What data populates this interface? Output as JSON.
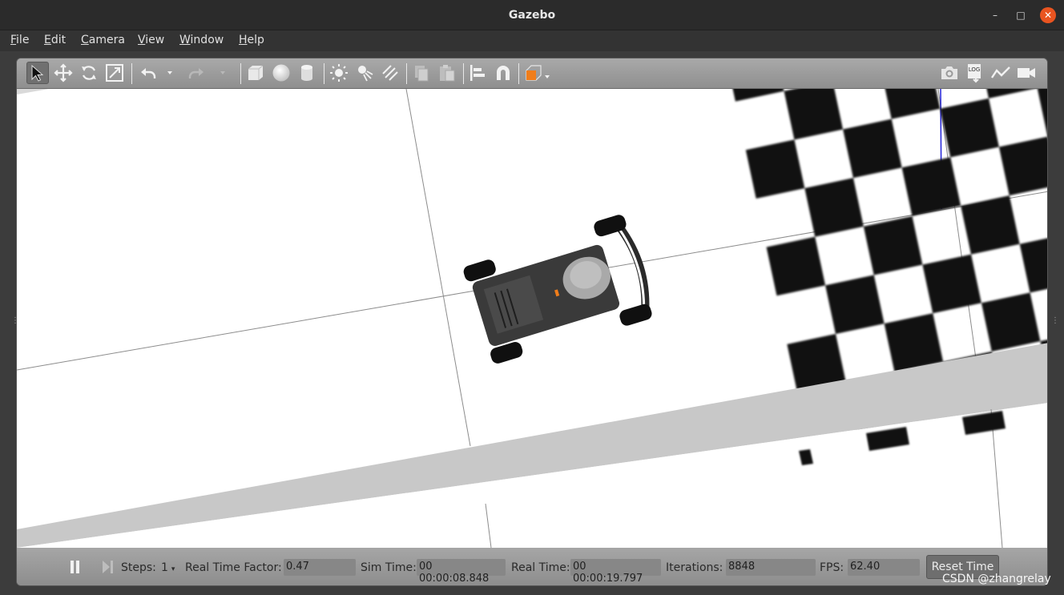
{
  "window": {
    "title": "Gazebo",
    "minimize": "–",
    "maximize": "□",
    "close": "✕"
  },
  "menu": [
    {
      "first": "F",
      "rest": "ile"
    },
    {
      "first": "E",
      "rest": "dit"
    },
    {
      "first": "C",
      "rest": "amera"
    },
    {
      "first": "V",
      "rest": "iew"
    },
    {
      "first": "W",
      "rest": "indow"
    },
    {
      "first": "H",
      "rest": "elp"
    }
  ],
  "toolbar": {
    "icons": [
      "select-icon",
      "translate-icon",
      "rotate-icon",
      "scale-icon",
      "undo-icon",
      "undo-dropdown-icon",
      "redo-icon",
      "redo-dropdown-icon",
      "box-icon",
      "sphere-icon",
      "cylinder-icon",
      "point-light-icon",
      "spot-light-icon",
      "directional-light-icon",
      "copy-icon",
      "paste-icon",
      "align-icon",
      "snap-icon",
      "view-angle-icon",
      "screenshot-icon",
      "log-icon",
      "plot-icon",
      "video-record-icon"
    ],
    "log_text": "LOG"
  },
  "colors": {
    "accent": "#e95420",
    "view_angle_orange": "#f07d1a",
    "toolbar": "#9a9a9a",
    "ground": "#ffffff",
    "ramp": "#c8c8c8"
  },
  "status": {
    "steps_label": "Steps:",
    "steps_value": "1",
    "rtf_label": "Real Time Factor:",
    "rtf_value": "0.47",
    "sim_time_label": "Sim Time:",
    "sim_time_value": "00 00:00:08.848",
    "real_time_label": "Real Time:",
    "real_time_value": "00 00:00:19.797",
    "iterations_label": "Iterations:",
    "iterations_value": "8848",
    "fps_label": "FPS:",
    "fps_value": "62.40",
    "reset_label": "Reset Time"
  },
  "watermark": "CSDN @zhangrelay"
}
